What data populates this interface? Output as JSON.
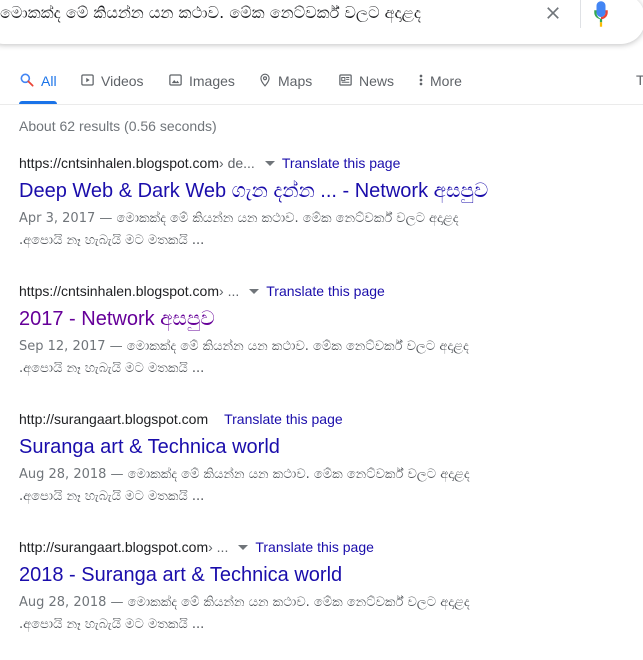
{
  "search": {
    "query": "මොකක්ද මේ කියන්න යන කථාව. මේක නෙට්වර්ක් වලට අදාළද"
  },
  "tabs": [
    {
      "label": "All",
      "icon": "search-icon",
      "active": true
    },
    {
      "label": "Videos",
      "icon": "video-icon"
    },
    {
      "label": "Images",
      "icon": "image-icon"
    },
    {
      "label": "Maps",
      "icon": "map-pin-icon"
    },
    {
      "label": "News",
      "icon": "news-icon"
    },
    {
      "label": "More",
      "icon": "more-vert-icon"
    }
  ],
  "tools_cut": "T",
  "stats": "About 62 results (0.56 seconds)",
  "translate_label": "Translate this page",
  "results": [
    {
      "url": "https://cntsinhalen.blogspot.com",
      "path": " › de...",
      "title": "Deep Web & Dark Web ගැන දන්න ... - Network අසපුව",
      "date": "Apr 3, 2017 — ",
      "snippet_1": "මොකක්ද මේ කියන්න යන කථාව. මේක නෙට්වර්ක් වලට අදාළද",
      "snippet_2": ".අපොයි නෑ හැබැයි මට මතකයි ..."
    },
    {
      "url": "https://cntsinhalen.blogspot.com",
      "path": " › ...",
      "title": "2017 - Network අසපුව",
      "date": "Sep 12, 2017 — ",
      "snippet_1": "මොකක්ද මේ කියන්න යන කථාව. මේක නෙට්වර්ක් වලට අදාළද",
      "snippet_2": ".අපොයි නෑ හැබැයි මට මතකයි ..."
    },
    {
      "url": "http://surangaart.blogspot.com",
      "path": "",
      "title": "Suranga art & Technica world",
      "date": "Aug 28, 2018 — ",
      "snippet_1": "මොකක්ද මේ කියන්න යන කථාව. මේක නෙට්වර්ක් වලට අදාළද",
      "snippet_2": ".අපොයි නෑ හැබැයි මට මතකයි ..."
    },
    {
      "url": "http://surangaart.blogspot.com",
      "path": " › ...",
      "title": "2018 - Suranga art & Technica world",
      "date": "Aug 28, 2018 — ",
      "snippet_1": "මොකක්ද මේ කියන්න යන කථාව. මේක නෙට්වර්ක් වලට අදාළද",
      "snippet_2": ".අපොයි නෑ හැබැයි මට මතකයි ..."
    }
  ],
  "colors": {
    "link": "#1a0dab",
    "visited": "#660099",
    "accent": "#1a73e8",
    "muted": "#70757a"
  }
}
